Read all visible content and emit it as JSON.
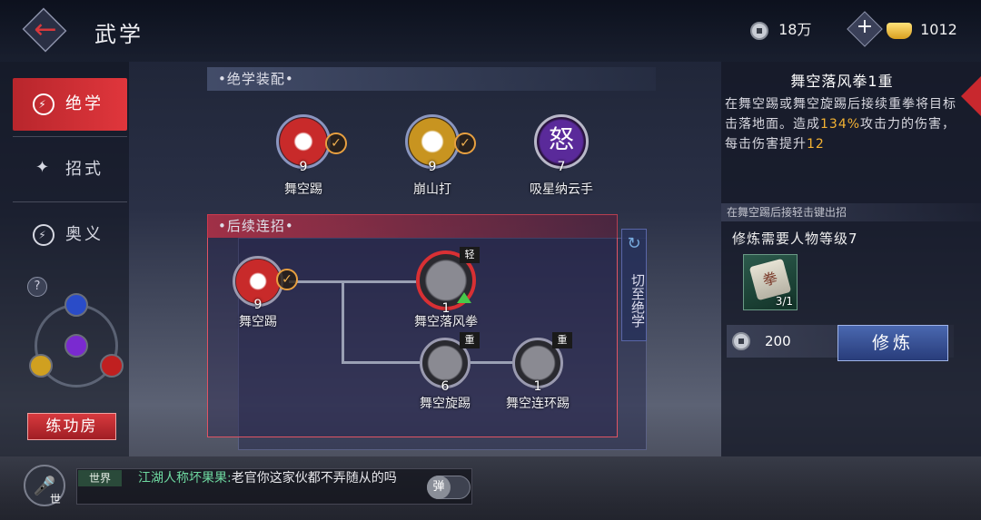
{
  "header": {
    "title": "武学",
    "silver": "18万",
    "gold": "1012"
  },
  "tabs": [
    {
      "label": "绝学"
    },
    {
      "label": "招式"
    },
    {
      "label": "奥义"
    }
  ],
  "left": {
    "help": "?",
    "training_room": "练功房"
  },
  "equip": {
    "header": "•绝学装配•",
    "slots": [
      {
        "name": "舞空踢",
        "level": "9",
        "icon_glyph": "",
        "equipped": true
      },
      {
        "name": "崩山打",
        "level": "9",
        "icon_glyph": "",
        "equipped": true
      },
      {
        "name": "吸星纳云手",
        "level": "7",
        "icon_glyph": "怒",
        "equipped": false
      }
    ]
  },
  "combo": {
    "header": "•后续连招•",
    "switch_label": "切至绝学",
    "nodes": [
      {
        "name": "舞空踢",
        "level": "9",
        "tag": ""
      },
      {
        "name": "舞空落风拳",
        "level": "1",
        "tag": "轻"
      },
      {
        "name": "舞空旋踢",
        "level": "6",
        "tag": "重"
      },
      {
        "name": "舞空连环踢",
        "level": "1",
        "tag": "重"
      }
    ]
  },
  "detail": {
    "title": "舞空落风拳1重",
    "desc_1": "在舞空踢或舞空旋踢后接续重拳将目标击落地面。造成",
    "desc_pct": "134%",
    "desc_2": "攻击力的伤害，每击伤害提升",
    "desc_num": "12",
    "note": "在舞空踢后接轻击键出招",
    "requirement": "修炼需要人物等级7",
    "item_glyph": "拳",
    "item_count": "3/1",
    "cost": "200",
    "train_button": "修炼"
  },
  "chat": {
    "mic_label": "世",
    "channel": "世界",
    "sender": "江湖人称坏果果:",
    "message": "老官你这家伙都不弄随从的吗",
    "toggle": "弹"
  },
  "colors": {
    "accent_red": "#d8383c",
    "highlight": "#f4b233",
    "chat_name": "#6ed8a0"
  }
}
